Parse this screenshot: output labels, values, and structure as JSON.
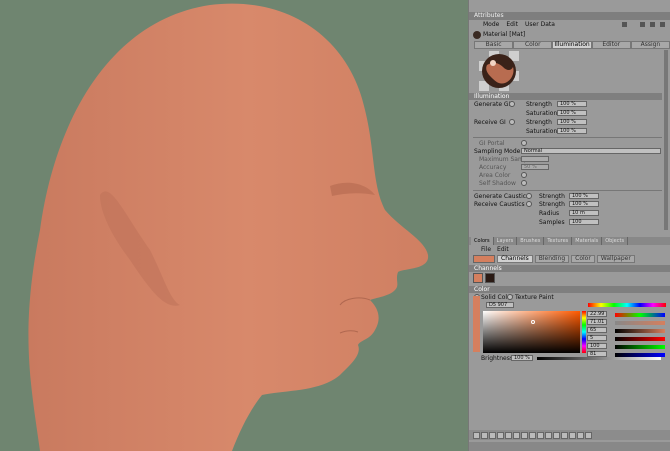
{
  "panel": {
    "title": "Attributes",
    "menu": [
      "Mode",
      "Edit",
      "User Data"
    ],
    "material_name": "Material [Mat]",
    "tabs": [
      "Basic",
      "Color",
      "Illumination",
      "Editor",
      "Assign"
    ],
    "active_tab": "Illumination",
    "section_illumination": "Illumination",
    "gi": {
      "generate_gi": "Generate GI",
      "receive_gi": "Receive GI",
      "strength_label": "Strength",
      "saturation_label": "Saturation",
      "generate_strength": "100 %",
      "generate_saturation": "100 %",
      "receive_strength": "100 %",
      "receive_saturation": "100 %"
    },
    "gi_portal": "GI Portal",
    "sampling_mode_label": "Sampling Mode",
    "sampling_mode_value": "Normal",
    "maximum_samples": "Maximum Samples",
    "accuracy": "Accuracy",
    "accuracy_value": "50 %",
    "area_color": "Area Color",
    "self_shadow": "Self Shadow",
    "caustics": {
      "generate": "Generate Caustics",
      "receive": "Receive Caustics",
      "strength_label": "Strength",
      "radius_label": "Radius",
      "samples_label": "Samples",
      "generate_strength": "100 %",
      "receive_strength": "100 %",
      "radius": "10 m",
      "samples": "100"
    }
  },
  "lower": {
    "tabs": [
      "Colors",
      "Layers",
      "Brushes",
      "Textures",
      "Materials",
      "Objects"
    ],
    "active_tab": "Colors",
    "menu": [
      "File",
      "Edit"
    ],
    "subtabs": [
      "Channels",
      "Blending",
      "Color",
      "Wallpaper"
    ],
    "channels_section": "Channels",
    "color_section": "Color",
    "solid_color": "Solid Color",
    "texture_paint": "Texture Paint",
    "hex_value": "D5 907",
    "rgb_values": [
      "22.99",
      "71.01",
      "65",
      "5",
      "100",
      "81"
    ],
    "brightness_label": "Brightness",
    "brightness_value": "100 %"
  },
  "colors": {
    "viewport_bg": "#6f8570",
    "skin": "#d6876a",
    "selected_color": "#d57f5e"
  }
}
